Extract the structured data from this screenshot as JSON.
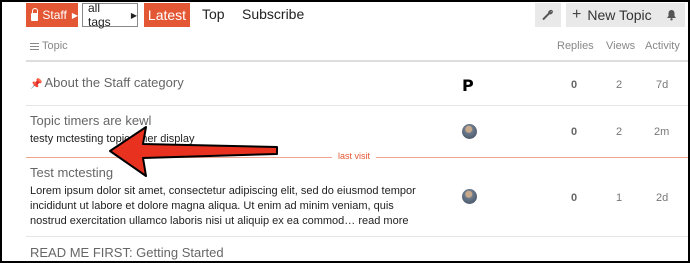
{
  "nav": {
    "category": "Staff",
    "tags": "all tags",
    "tabs": [
      "Latest",
      "Top",
      "Subscribe"
    ],
    "new_topic": "New Topic",
    "icons": {
      "lock": "lock-icon",
      "wrench": "wrench-icon",
      "plus": "plus-icon",
      "bell": "bell-icon"
    }
  },
  "headers": {
    "topic": "Topic",
    "replies": "Replies",
    "views": "Views",
    "activity": "Activity"
  },
  "topics": [
    {
      "title": "About the Staff category",
      "pinned": true,
      "replies": "0",
      "views": "2",
      "activity": "7d",
      "poster": "P"
    },
    {
      "title": "Topic timers are kewl",
      "subtitle": "testy mctesting topic timer display",
      "replies": "0",
      "views": "2",
      "activity": "2m"
    },
    {
      "title": "Test mctesting",
      "excerpt": "Lorem ipsum dolor sit amet, consectetur adipiscing elit, sed do eiusmod tempor incididunt ut labore et dolore magna aliqua. Ut enim ad minim veniam, quis nostrud exercitation ullamco laboris nisi ut aliquip ex ea commod…",
      "read_more": "read more",
      "replies": "0",
      "views": "1",
      "activity": "2d"
    },
    {
      "title": "READ ME FIRST: Getting Started"
    }
  ],
  "last_visit": "last visit",
  "colors": {
    "accent": "#e45735",
    "arrow": "#e8311f"
  }
}
